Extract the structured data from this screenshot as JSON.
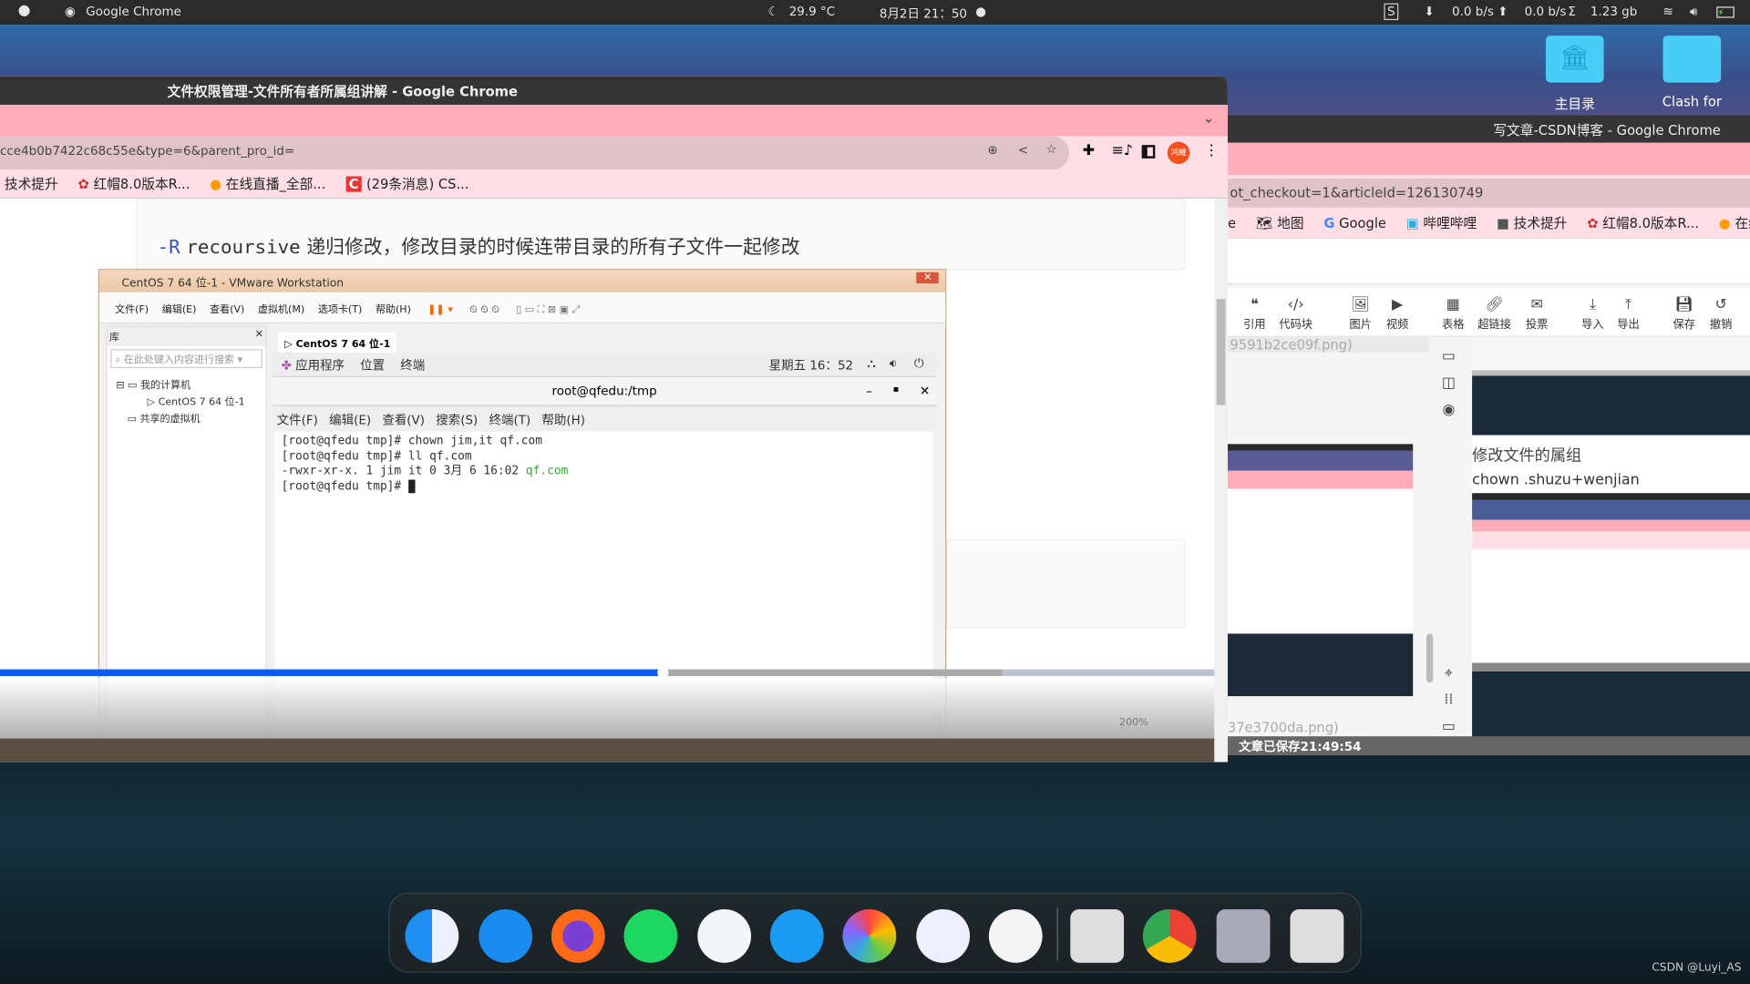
{
  "topbar": {
    "app_name": "Google Chrome",
    "weather": "29.9 °C",
    "datetime": "8月2日 21：50",
    "net_down": "0.0 b/s",
    "net_up": "0.0 b/s",
    "total": "1.23 gb"
  },
  "desktop": {
    "icons": [
      {
        "label": "主目录"
      },
      {
        "label": "Clash for"
      }
    ],
    "watermark": "CSDN @Luyi_AS"
  },
  "left_window": {
    "title": "文件权限管理-文件所有者所属组讲解 - Google Chrome",
    "url": "cce4b0b7422c68c55e&type=6&parent_pro_id=",
    "profile": "鸿耀",
    "bookmarks": [
      "技术提升",
      "红帽8.0版本R...",
      "在线直播_全部...",
      "(29条消息) CS..."
    ],
    "content_line": {
      "flag": "-R",
      "keyword": "recoursive",
      "desc": "递归修改，修改目录的时候连带目录的所有子文件一起修改"
    },
    "video_progress_percent": 54.6,
    "vmware": {
      "title": "CentOS 7 64 位-1 - VMware Workstation",
      "menu": [
        "文件(F)",
        "编辑(E)",
        "查看(V)",
        "虚拟机(M)",
        "选项卡(T)",
        "帮助(H)"
      ],
      "library_label": "库",
      "search_placeholder": "在此处键入内容进行搜索",
      "tree": [
        "我的计算机",
        "CentOS 7 64 位-1",
        "共享的虚拟机"
      ],
      "tab": "CentOS 7 64 位-1",
      "zoom": "200%",
      "gnome": {
        "menu": [
          "应用程序",
          "位置",
          "终端"
        ],
        "clock": "星期五 16：52"
      },
      "terminal": {
        "title": "root@qfedu:/tmp",
        "menu": [
          "文件(F)",
          "编辑(E)",
          "查看(V)",
          "搜索(S)",
          "终端(T)",
          "帮助(H)"
        ],
        "lines": [
          "[root@qfedu tmp]# chown jim,it qf.com",
          "[root@qfedu tmp]# ll qf.com",
          "-rwxr-xr-x. 1 jim it 0 3月   6 16:02 "
        ],
        "file_highlight": "qf.com",
        "prompt": "[root@qfedu tmp]# "
      }
    }
  },
  "right_window": {
    "title": "写文章-CSDN博客 - Google Chrome",
    "url": "ot_checkout=1&articleId=126130749",
    "bookmarks": [
      "e",
      "地图",
      "Google",
      "哔哩哔哩",
      "技术提升",
      "红帽8.0版本R...",
      "在线"
    ],
    "toolbar": [
      {
        "label": "引用",
        "icon": "quote"
      },
      {
        "label": "代码块",
        "icon": "code"
      },
      {
        "label": "图片",
        "icon": "image"
      },
      {
        "label": "视频",
        "icon": "video"
      },
      {
        "label": "表格",
        "icon": "table"
      },
      {
        "label": "超链接",
        "icon": "link"
      },
      {
        "label": "投票",
        "icon": "vote"
      },
      {
        "label": "导入",
        "icon": "import"
      },
      {
        "label": "导出",
        "icon": "export"
      },
      {
        "label": "保存",
        "icon": "save"
      },
      {
        "label": "撤销",
        "icon": "undo"
      }
    ],
    "editor_lines": [
      "9591b2ce09f.png)",
      "37e3700da.png)"
    ],
    "preview": {
      "heading": "修改文件的属组",
      "text": "chown .shuzu+wenjian"
    },
    "status": "文章已保存21:49:54"
  },
  "dock": [
    "finder",
    "app-store",
    "firefox",
    "spotify",
    "baidu-netdisk",
    "files",
    "photos",
    "teamviewer",
    "todo",
    "trash",
    "chrome",
    "disk-utility",
    "launchpad"
  ]
}
